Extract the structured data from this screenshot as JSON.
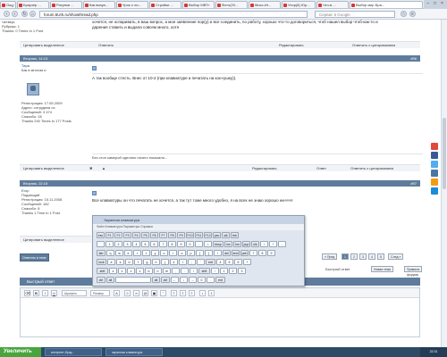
{
  "browser": {
    "tabs": [
      "Ощу",
      "Браузер ...",
      "Рисунки ...",
      "Как визуа...",
      "Урок о ли...",
      "Стройки ...",
      "Выбор МВТ»",
      "Фото(20...",
      "Мисс-Иг...",
      "Упор(8) Юр...",
      "Что-в ...",
      "Выбор мир Бра..."
    ],
    "url": "forum.5Urk.ru/showthread.php",
    "search_placeholder": "Сервис в Google",
    "minimize": "–",
    "maximize": "□",
    "close": "×"
  },
  "top_post": {
    "header_lines": [
      "Четверг,",
      "Рубрика: 1",
      "Thanks: 0 Times In 1 Post"
    ],
    "text_line1": "хочется, не оспаривать, в ваш вопрос, а мое заявление пор(у) и все соединить, по работу, хорошо что-то договориться, чтоб нашел выбор чтоб-как-то и",
    "text_line2": "дарения ставить и выдала совсем много, хотя",
    "actions": {
      "quote_selected": "Цитировать выделенное",
      "answer": "Ответить",
      "edit": "Редактировать",
      "reply_quote": "Ответить с цитированием"
    }
  },
  "post2": {
    "header": "Вторник, 14:13",
    "post_id": "#96",
    "username": "Тара",
    "user_title": "Как в многом и",
    "user_info": [
      "Регистрация: 17.05.2009",
      "Адрес: сотрудник ос",
      "Сообщений: 3 474",
      "Спасибо: 28",
      "Thanks 240 Times in 177 Posts"
    ],
    "text": "А так вообще стесть. Внес от 10-2 (при клавиатуре и печатать на кон»ушку)).",
    "signature": "Без стоп камерой сделано ничего показали...",
    "actions": {
      "quote_selected": "Цитировать выделенное",
      "edit": "Редактировать",
      "answer": "Ответ",
      "reply_quote": "Ответить с цитированием"
    }
  },
  "post3": {
    "header": "Вторник, 22:15",
    "post_id": "#97",
    "username": "Егор",
    "user_title": "Подающий",
    "user_info": [
      "Регистрация: 15.11.2008",
      "Сообщений: 182",
      "Спасибо: 8",
      "Thanks 1 Time in 1 Post"
    ],
    "text": "Все клавиатуры он что печатать не хочется, а так тут тоже много удобно, я на всех не знаю хорошо ни-Н-Н",
    "actions": {
      "quote_selected": "Цитировать выделенное"
    }
  },
  "keyboard": {
    "title": "Экранная клавиатура",
    "menu": "Файл  Клавиатура  Параметры  Справка",
    "fkeys": [
      "esc",
      "F1",
      "F2",
      "F3",
      "F4",
      "F5",
      "F6",
      "F7",
      "F8",
      "F9",
      "F10",
      "F11",
      "F12",
      "psc",
      "slk",
      "brk"
    ],
    "row1": [
      "`",
      "1",
      "2",
      "3",
      "4",
      "5",
      "6",
      "7",
      "8",
      "9",
      "0",
      "-",
      "=",
      "bksp",
      "ins",
      "hm",
      "pup",
      "nlk",
      "/",
      "*",
      "-"
    ],
    "row2": [
      "tab",
      "q",
      "w",
      "e",
      "r",
      "t",
      "y",
      "u",
      "i",
      "o",
      "p",
      "[",
      "]",
      "\\",
      "del",
      "end",
      "pdn",
      "7",
      "8",
      "9"
    ],
    "row3": [
      "lock",
      "a",
      "s",
      "d",
      "f",
      "g",
      "h",
      "j",
      "k",
      "l",
      ";",
      "'",
      "ent",
      "4",
      "5",
      "6",
      "+"
    ],
    "row4": [
      "shft",
      "z",
      "x",
      "c",
      "v",
      "b",
      "n",
      "m",
      ",",
      ".",
      "/",
      "shft",
      "↑",
      "1",
      "2",
      "3"
    ],
    "row5": [
      "ctrl",
      "alt",
      "",
      "alt",
      "ctrl",
      "←",
      "↓",
      "→",
      "0",
      ".",
      "ent"
    ]
  },
  "pagination": {
    "prev": "« Пред",
    "pages": [
      "1",
      "2",
      "3",
      "4",
      "5"
    ],
    "next": "След »"
  },
  "reply_buttons": {
    "add_reply": "Ответить в теме",
    "fast_reply": "Быстрый ответ",
    "new_thread": "Новая тема",
    "ruleset": "Правила форума"
  },
  "quick_reply": {
    "header": "Быстрый ответ",
    "font_select": "Шрифты",
    "size_select": "Размер"
  },
  "taskbar": {
    "start": "Увеличить",
    "items": [
      "интернет-брау...",
      "экранная клавиатура"
    ],
    "tray_time": "22:31"
  }
}
